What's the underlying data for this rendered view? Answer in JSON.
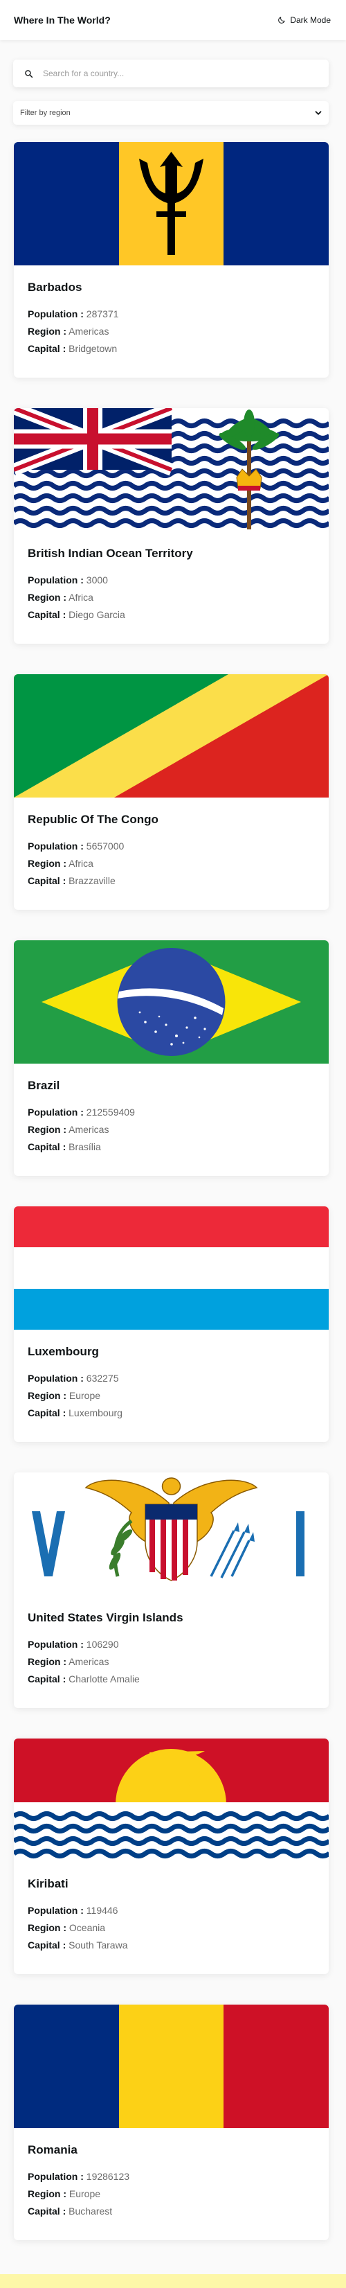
{
  "header": {
    "title": "Where In The World?",
    "dark_mode_label": "Dark Mode"
  },
  "search": {
    "placeholder": "Search for a country...",
    "value": ""
  },
  "filter": {
    "placeholder": "Filter by region"
  },
  "labels": {
    "population": "Population :",
    "region": "Region :",
    "capital": "Capital :"
  },
  "countries": [
    {
      "name": "Barbados",
      "population": "287371",
      "region": "Americas",
      "capital": "Bridgetown",
      "flag": "barbados"
    },
    {
      "name": "British Indian Ocean Territory",
      "population": "3000",
      "region": "Africa",
      "capital": "Diego Garcia",
      "flag": "biot"
    },
    {
      "name": "Republic Of The Congo",
      "population": "5657000",
      "region": "Africa",
      "capital": "Brazzaville",
      "flag": "congo"
    },
    {
      "name": "Brazil",
      "population": "212559409",
      "region": "Americas",
      "capital": "Brasília",
      "flag": "brazil"
    },
    {
      "name": "Luxembourg",
      "population": "632275",
      "region": "Europe",
      "capital": "Luxembourg",
      "flag": "luxembourg"
    },
    {
      "name": "United States Virgin Islands",
      "population": "106290",
      "region": "Americas",
      "capital": "Charlotte Amalie",
      "flag": "usvi"
    },
    {
      "name": "Kiribati",
      "population": "119446",
      "region": "Oceania",
      "capital": "South Tarawa",
      "flag": "kiribati"
    },
    {
      "name": "Romania",
      "population": "19286123",
      "region": "Europe",
      "capital": "Bucharest",
      "flag": "romania"
    }
  ],
  "colors": {
    "background": "#fafafa",
    "card": "#ffffff",
    "text": "#111517",
    "muted": "#6b6b6b",
    "footer_strip": "#fdf7a8"
  }
}
